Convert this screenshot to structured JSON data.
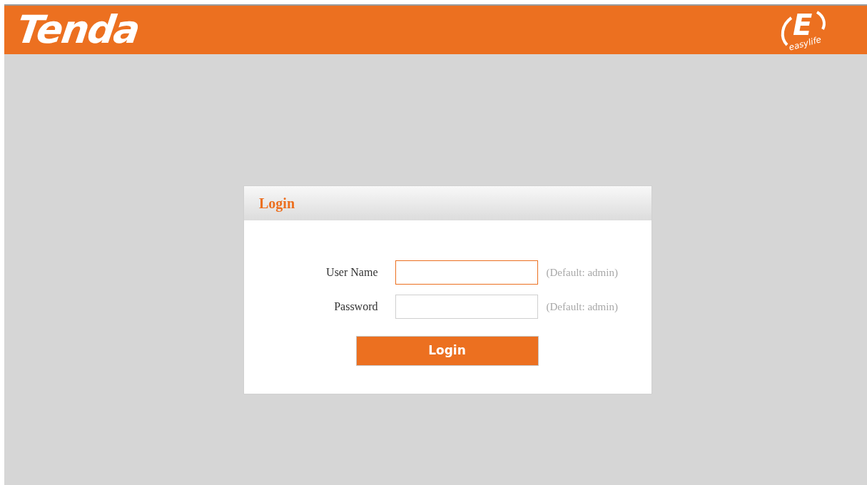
{
  "header": {
    "logo": "Tenda",
    "badge": {
      "letter": "E",
      "tagline": "easylife"
    }
  },
  "login": {
    "title": "Login",
    "fields": [
      {
        "label": "User Name",
        "focused": true,
        "hint": "(Default: admin)"
      },
      {
        "label": "Password",
        "focused": false,
        "hint": "(Default: admin)"
      }
    ],
    "button": "Login"
  }
}
